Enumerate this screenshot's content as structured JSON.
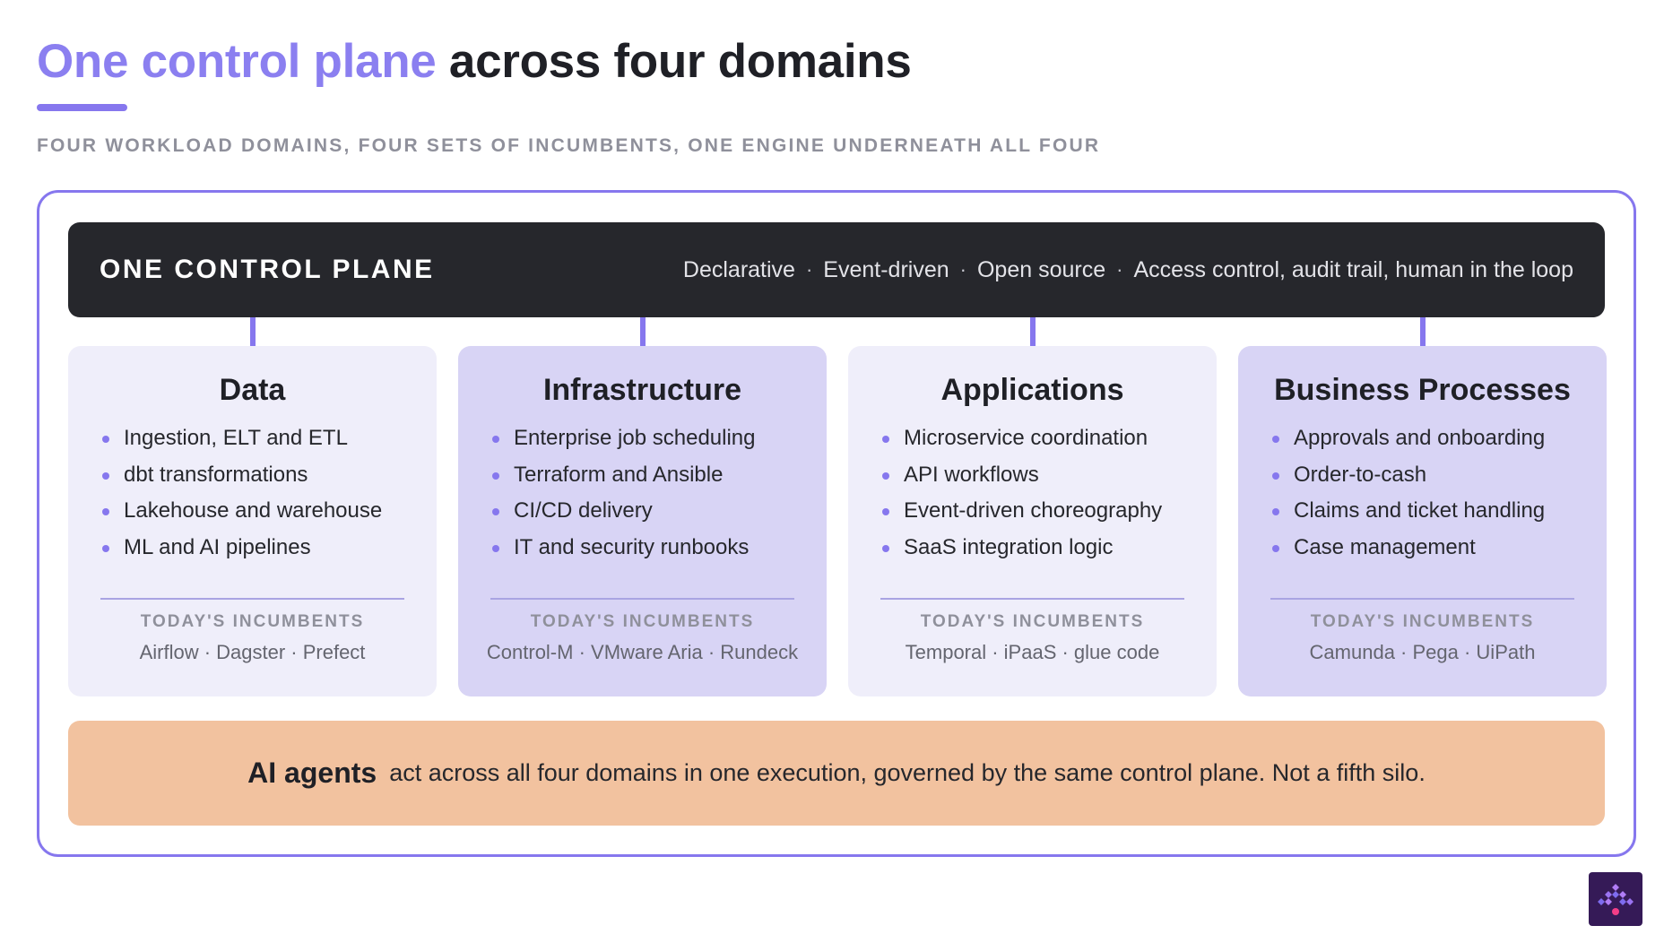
{
  "header": {
    "title_accent": "One control plane",
    "title_rest": "across four domains",
    "subtitle": "FOUR WORKLOAD DOMAINS, FOUR SETS OF INCUMBENTS, ONE ENGINE UNDERNEATH ALL FOUR"
  },
  "control_plane": {
    "title": "ONE CONTROL PLANE",
    "features": [
      "Declarative",
      "Event-driven",
      "Open source",
      "Access control, audit trail, human in the loop"
    ],
    "separator": "·"
  },
  "domains": [
    {
      "title": "Data",
      "items": [
        "Ingestion, ELT and ETL",
        "dbt transformations",
        "Lakehouse and warehouse",
        "ML and AI pipelines"
      ],
      "incumbents_label": "TODAY'S INCUMBENTS",
      "incumbents": "Airflow · Dagster · Prefect"
    },
    {
      "title": "Infrastructure",
      "items": [
        "Enterprise job scheduling",
        "Terraform and Ansible",
        "CI/CD delivery",
        "IT and security runbooks"
      ],
      "incumbents_label": "TODAY'S INCUMBENTS",
      "incumbents": "Control-M · VMware Aria · Rundeck"
    },
    {
      "title": "Applications",
      "items": [
        "Microservice coordination",
        "API workflows",
        "Event-driven choreography",
        "SaaS integration logic"
      ],
      "incumbents_label": "TODAY'S INCUMBENTS",
      "incumbents": "Temporal · iPaaS · glue code"
    },
    {
      "title": "Business Processes",
      "items": [
        "Approvals and onboarding",
        "Order-to-cash",
        "Claims and ticket handling",
        "Case management"
      ],
      "incumbents_label": "TODAY'S INCUMBENTS",
      "incumbents": "Camunda · Pega · UiPath"
    }
  ],
  "agents": {
    "lead": "AI agents",
    "body": "act across all four domains in one execution, governed by the same control plane. Not a fifth silo."
  },
  "colors": {
    "accent": "#8677ee",
    "plane_bg": "#26272c",
    "card_light": "#efeefa",
    "card_dark": "#d8d4f5",
    "agents_bg": "#f2c29f",
    "logo_bg": "#351a57"
  },
  "icons": {
    "brand_logo": "brand-logo-icon"
  }
}
